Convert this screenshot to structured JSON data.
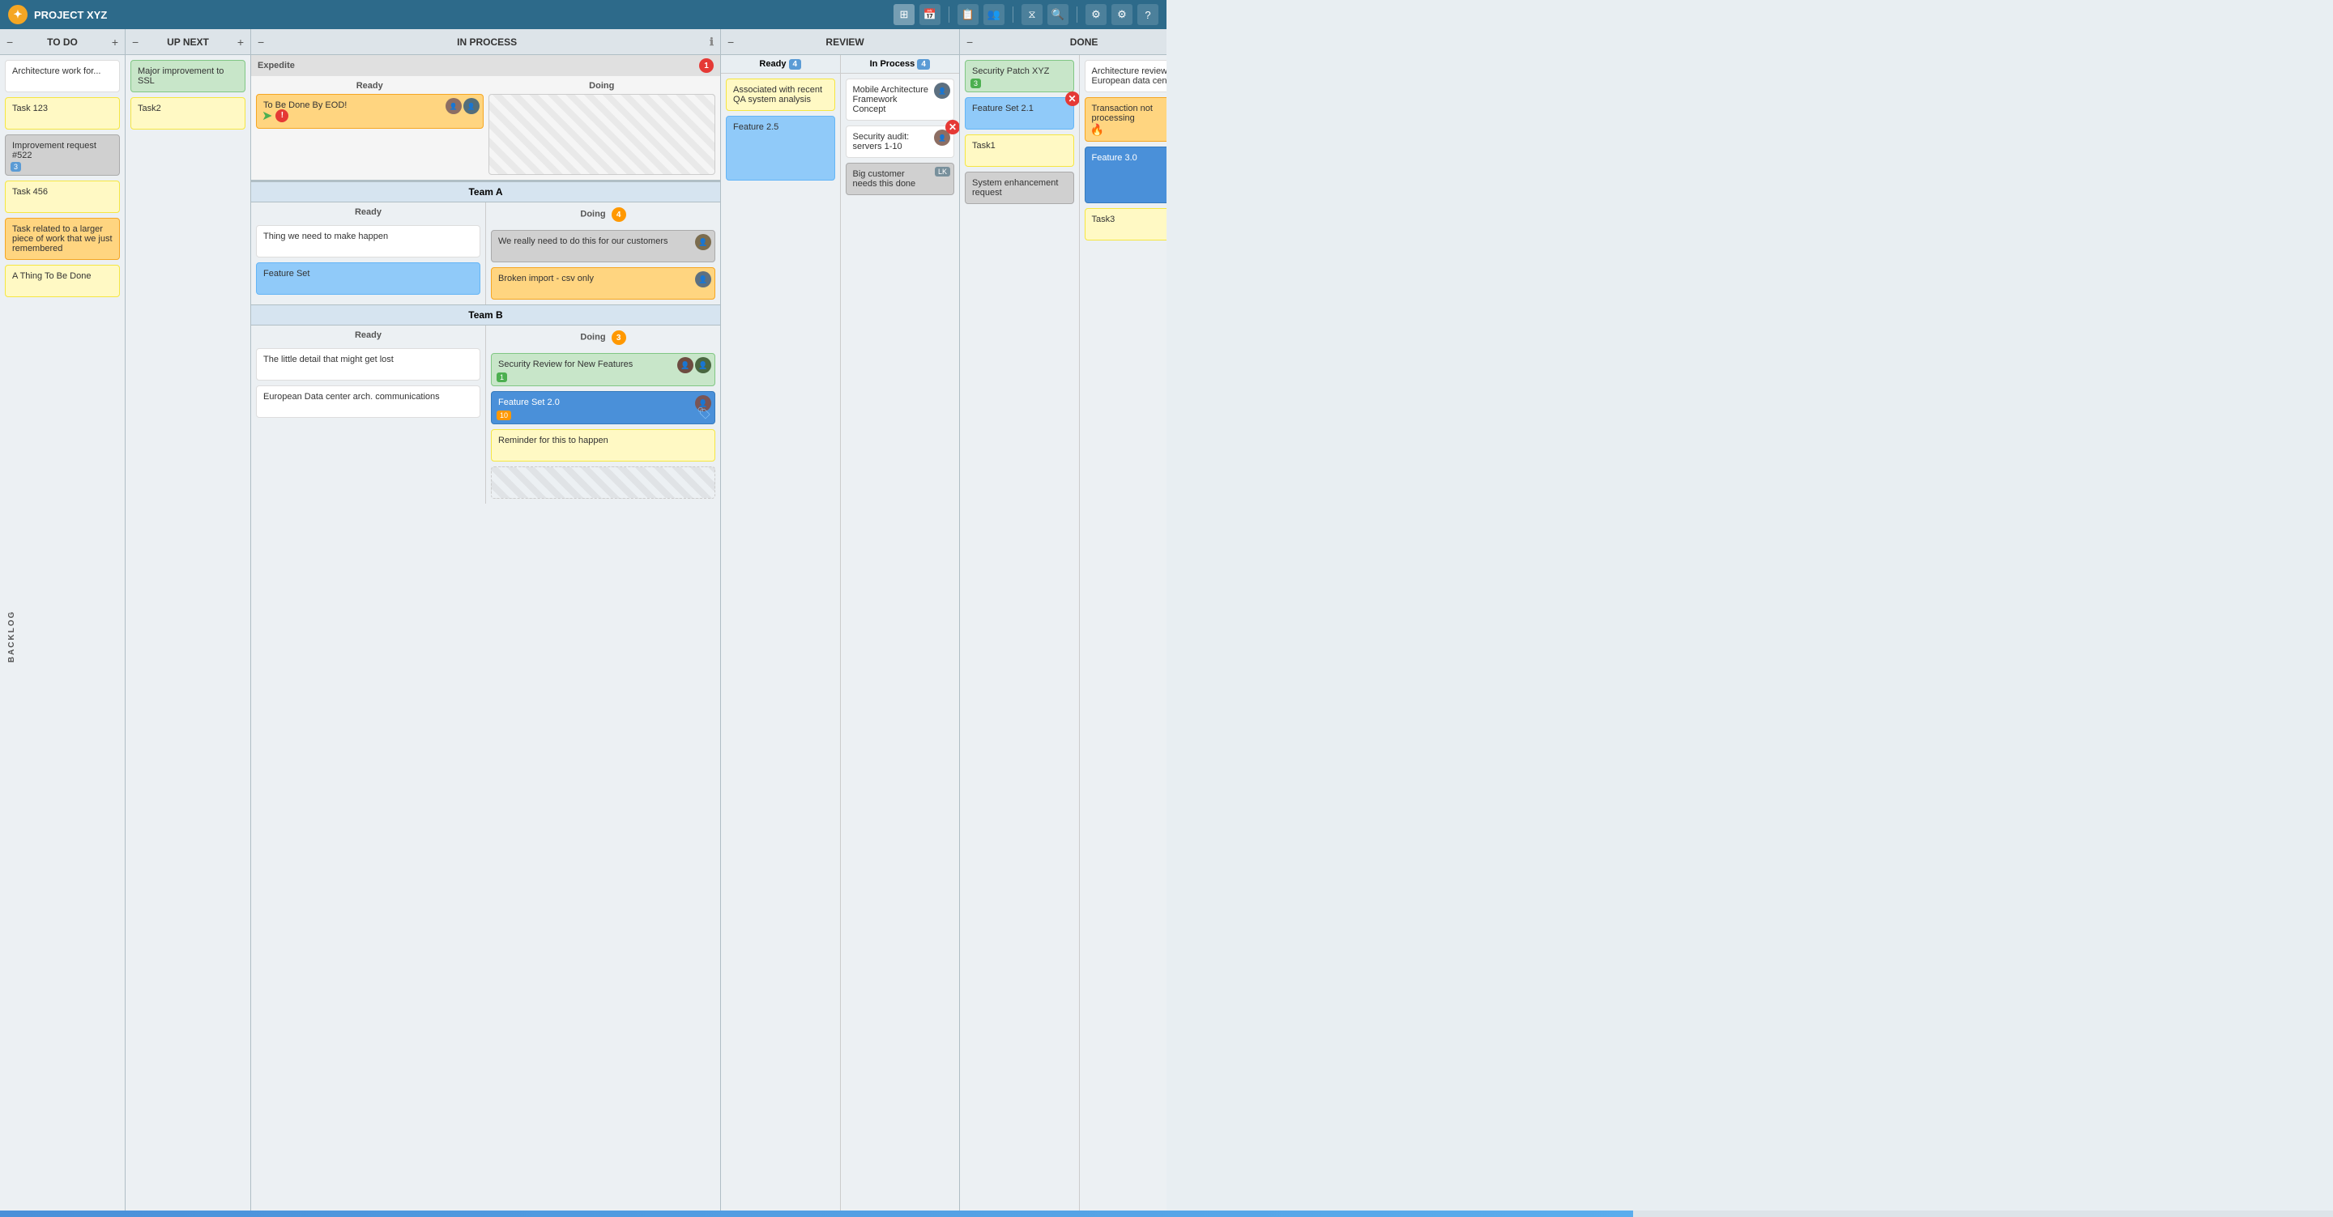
{
  "app": {
    "title": "PROJECT XYZ",
    "logo": "★"
  },
  "header": {
    "icons": [
      "⊞",
      "📅",
      "📋",
      "👥",
      "⧖",
      "🔍",
      "⚙",
      "?"
    ]
  },
  "columns": {
    "todo": {
      "label": "TO DO",
      "cards": [
        {
          "text": "Architecture work for...",
          "color": "white"
        },
        {
          "text": "Task 123",
          "color": "yellow"
        },
        {
          "text": "Improvement request #522",
          "color": "gray",
          "badge": "3"
        },
        {
          "text": "Task 456",
          "color": "yellow"
        },
        {
          "text": "Task related to a larger piece of work that we just remembered",
          "color": "orange"
        },
        {
          "text": "A Thing To Be Done",
          "color": "yellow"
        }
      ]
    },
    "upnext": {
      "label": "UP NEXT",
      "cards": [
        {
          "text": "Major improvement to SSL",
          "color": "green"
        },
        {
          "text": "Task2",
          "color": "yellow"
        }
      ]
    },
    "inprocess": {
      "label": "IN PROCESS",
      "expedite": {
        "label": "Expedite",
        "count": 1,
        "ready_cards": [
          {
            "text": "To Be Done By EOD!",
            "color": "orange",
            "has_arrow": true,
            "has_priority": true,
            "avatars": [
              "👤",
              "👤"
            ]
          }
        ],
        "doing_cards": []
      },
      "teams": [
        {
          "name": "Team A",
          "ready_cards": [
            {
              "text": "Thing we need to make happen",
              "color": "white"
            },
            {
              "text": "Feature Set",
              "color": "blue-light"
            }
          ],
          "doing_label": "Doing",
          "doing_count": 4,
          "doing_cards": [
            {
              "text": "We really need to do this for our customers",
              "color": "gray",
              "has_avatar": true
            },
            {
              "text": "Broken import - csv only",
              "color": "orange",
              "has_avatar": true
            }
          ]
        },
        {
          "name": "Team B",
          "ready_cards": [
            {
              "text": "The little detail that might get lost",
              "color": "white"
            },
            {
              "text": "European Data center arch. communications",
              "color": "white"
            }
          ],
          "doing_label": "Doing",
          "doing_count": 3,
          "doing_cards": [
            {
              "text": "Security Review for New Features",
              "color": "green",
              "badge": "1",
              "has_avatar": true
            },
            {
              "text": "Feature Set 2.0",
              "color": "blue",
              "badge": "10",
              "has_avatar": true,
              "has_tag": true
            },
            {
              "text": "Reminder for this to happen",
              "color": "yellow"
            }
          ]
        }
      ]
    },
    "review": {
      "label": "REVIEW",
      "subs": [
        {
          "label": "Ready",
          "count": 4,
          "cards": [
            {
              "text": "Associated with recent QA system analysis",
              "color": "yellow"
            },
            {
              "text": "Feature 2.5",
              "color": "blue-light"
            }
          ]
        },
        {
          "label": "In Process",
          "count": 4,
          "cards": [
            {
              "text": "Mobile Architecture Framework Concept",
              "color": "white",
              "has_avatar": true
            },
            {
              "text": "Security audit: servers 1-10",
              "color": "white",
              "has_avatar": true,
              "has_x": true
            },
            {
              "text": "Big customer needs this done",
              "color": "gray",
              "uk": true
            }
          ]
        }
      ]
    },
    "done": {
      "label": "DONE",
      "left_cards": [
        {
          "text": "Security Patch XYZ",
          "color": "green",
          "badge": "3"
        },
        {
          "text": "Feature Set 2.1",
          "color": "blue-light",
          "has_x": true
        },
        {
          "text": "Task1",
          "color": "yellow"
        },
        {
          "text": "System enhancement request",
          "color": "gray"
        }
      ],
      "right_cards": [
        {
          "text": "Architecture review for European data center",
          "color": "white"
        },
        {
          "text": "Transaction not processing",
          "color": "orange",
          "has_priority": true
        },
        {
          "text": "Feature 3.0",
          "color": "blue"
        },
        {
          "text": "Task3",
          "color": "yellow"
        }
      ]
    }
  }
}
